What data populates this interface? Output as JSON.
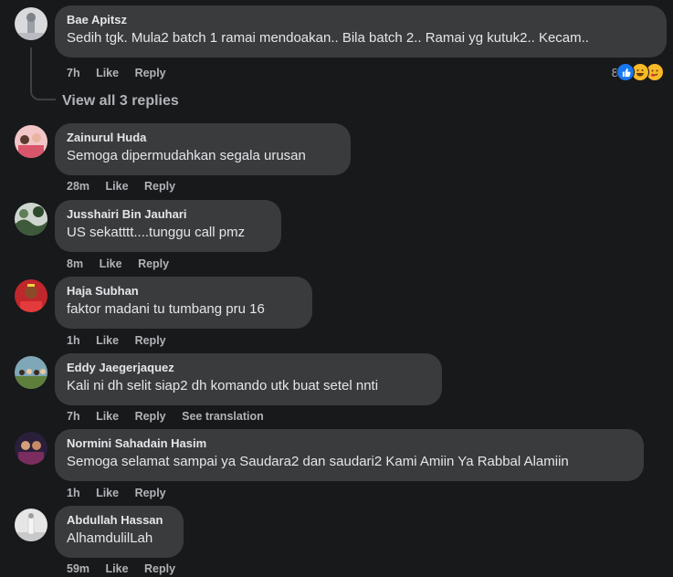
{
  "thread": {
    "view_replies_label": "View all 3 replies",
    "top_comment": {
      "author": "Bae Apitsz",
      "text": "Sedih tgk. Mula2 batch 1 ramai mendoakan.. Bila batch 2.. Ramai yg kutuk2.. Kecam..",
      "time": "7h",
      "like_label": "Like",
      "reply_label": "Reply",
      "reaction_count": "8",
      "reactions": [
        "like",
        "haha",
        "care"
      ]
    }
  },
  "comments": [
    {
      "author": "Zainurul Huda",
      "text": "Semoga dipermudahkan segala urusan",
      "time": "28m",
      "like_label": "Like",
      "reply_label": "Reply"
    },
    {
      "author": "Jusshairi Bin Jauhari",
      "text": "US sekatttt....tunggu call pmz",
      "time": "8m",
      "like_label": "Like",
      "reply_label": "Reply"
    },
    {
      "author": "Haja Subhan",
      "text": "faktor madani tu tumbang pru 16",
      "time": "1h",
      "like_label": "Like",
      "reply_label": "Reply"
    },
    {
      "author": "Eddy Jaegerjaquez",
      "text": "Kali ni dh selit siap2 dh komando utk buat setel nnti",
      "time": "7h",
      "like_label": "Like",
      "reply_label": "Reply",
      "translate_label": "See translation"
    },
    {
      "author": "Normini Sahadain Hasim",
      "text": "Semoga selamat sampai ya Saudara2 dan saudari2 Kami Amiin Ya Rabbal Alamiin",
      "time": "1h",
      "like_label": "Like",
      "reply_label": "Reply"
    },
    {
      "author": "Abdullah Hassan",
      "text": "AlhamdulilLah",
      "time": "59m",
      "like_label": "Like",
      "reply_label": "Reply"
    }
  ],
  "colors": {
    "background": "#18191a",
    "bubble": "#3a3b3c",
    "primary_text": "#e4e6eb",
    "secondary_text": "#b0b3b8",
    "like_blue": "#1877f2",
    "haha_yellow": "#f7b928"
  }
}
